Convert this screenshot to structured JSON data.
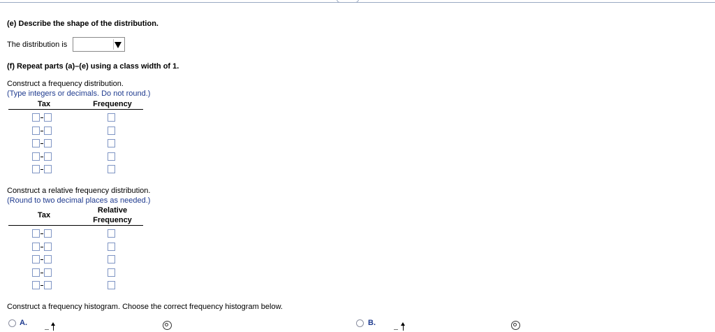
{
  "part_e": {
    "heading": "(e) Describe the shape of the distribution.",
    "prompt": "The distribution is",
    "dropdown_value": ""
  },
  "part_f": {
    "heading": "(f) Repeat parts (a)–(e) using a class width of 1."
  },
  "freq_table": {
    "instruction": "Construct a frequency distribution.",
    "hint": "(Type integers or decimals. Do not round.)",
    "col1": "Tax",
    "col2": "Frequency",
    "rows": 5
  },
  "rel_table": {
    "instruction": "Construct a relative frequency distribution.",
    "hint": "(Round to two decimal places as needed.)",
    "col1": "Tax",
    "col2_line1": "Relative",
    "col2_line2": "Frequency",
    "rows": 5
  },
  "histogram": {
    "instruction": "Construct a frequency histogram. Choose the correct frequency histogram below.",
    "options": [
      {
        "label": "A."
      },
      {
        "label": "B."
      }
    ]
  },
  "icons": {
    "zoom": "zoom-in-icon",
    "dropdown": "chevron-down-icon"
  }
}
